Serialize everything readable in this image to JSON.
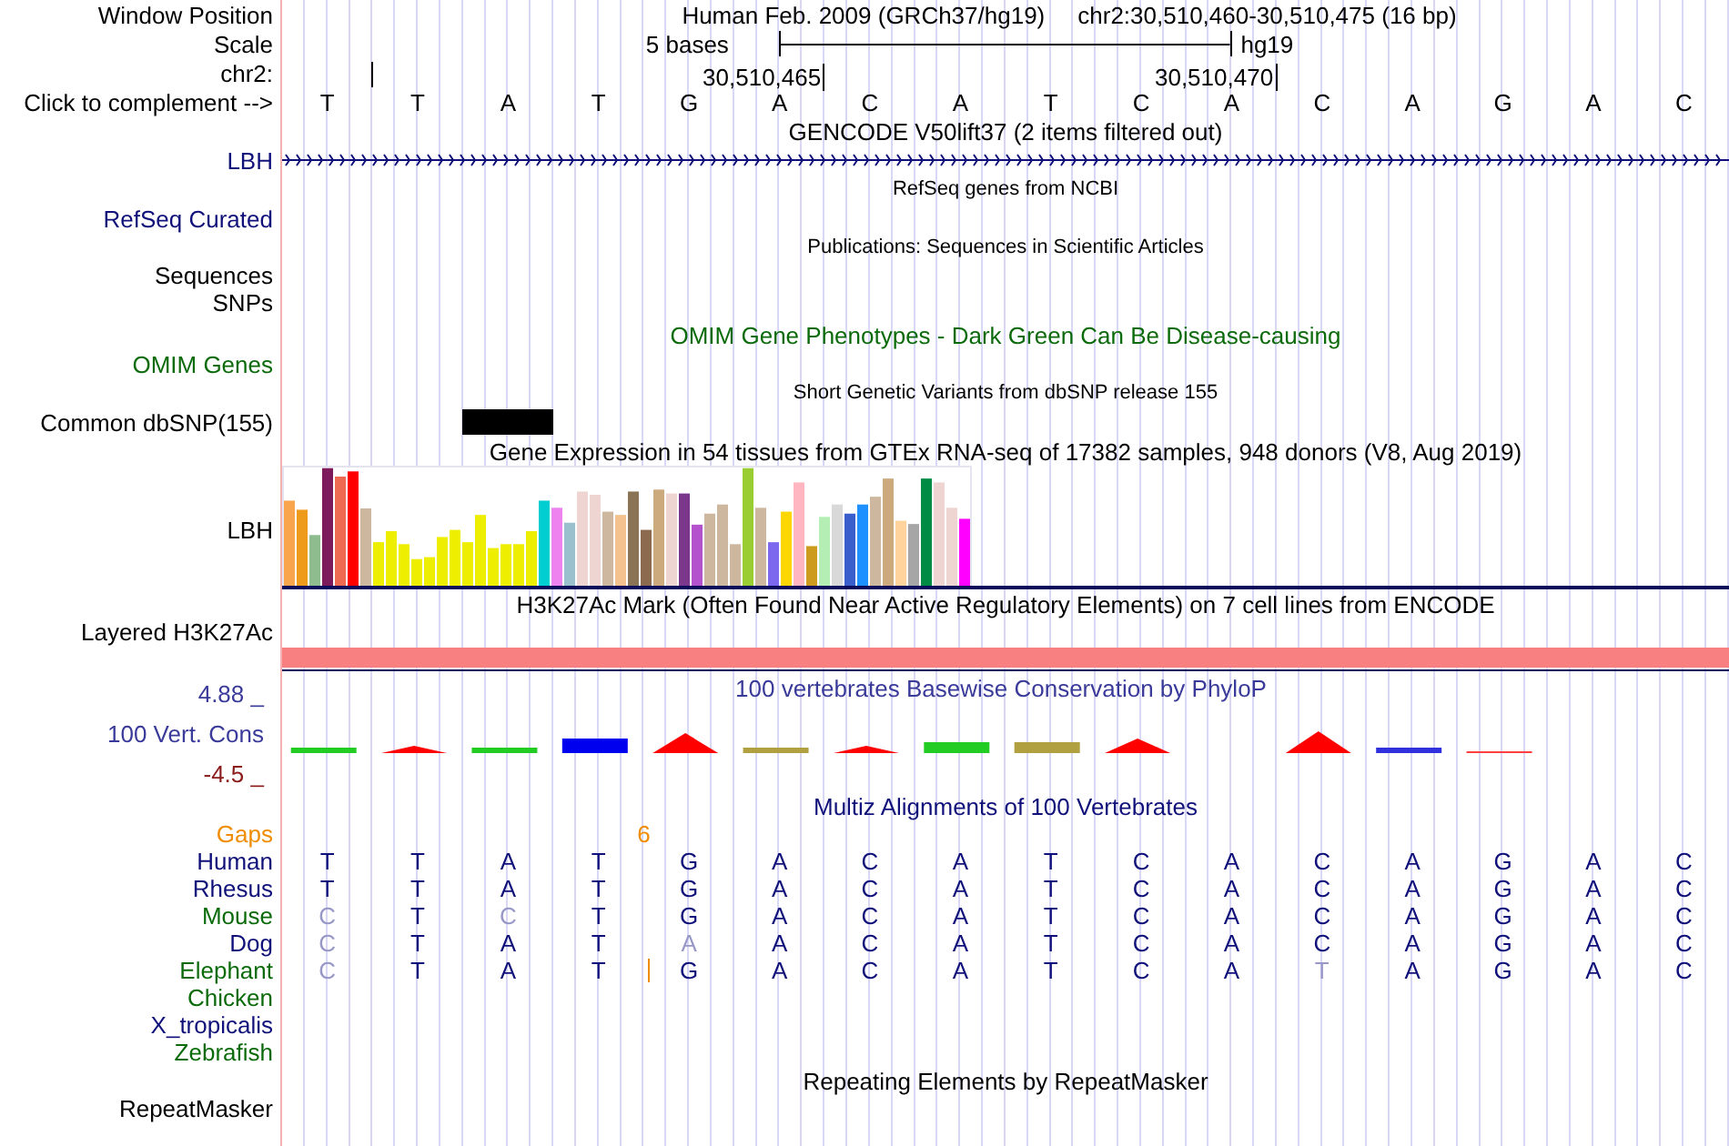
{
  "header": {
    "label": "Window Position",
    "assembly": "Human Feb. 2009 (GRCh37/hg19)",
    "position": "chr2:30,510,460-30,510,475 (16 bp)"
  },
  "scale": {
    "label": "Scale",
    "span": "5 bases",
    "assembly": "hg19"
  },
  "ruler": {
    "label": "chr2:",
    "ticks": [
      "30,510,465",
      "30,510,470"
    ]
  },
  "sequence": {
    "label": "Click to complement -->",
    "bases": [
      "T",
      "T",
      "A",
      "T",
      "G",
      "A",
      "C",
      "A",
      "T",
      "C",
      "A",
      "C",
      "A",
      "G",
      "A",
      "C"
    ]
  },
  "tracks": [
    {
      "kind": "title",
      "title": "GENCODE V50lift37 (2 items filtered out)",
      "color": "#000000"
    },
    {
      "kind": "gene",
      "label": "LBH",
      "color": "#10107a"
    },
    {
      "kind": "small_title",
      "title": "RefSeq genes from NCBI",
      "color": "#000000"
    },
    {
      "kind": "label",
      "label": "RefSeq Curated",
      "color": "#10107a"
    },
    {
      "kind": "small_title",
      "title": "Publications: Sequences in Scientific Articles",
      "color": "#000000"
    },
    {
      "kind": "label",
      "label": "Sequences",
      "color": "#000000"
    },
    {
      "kind": "label",
      "label": "SNPs",
      "color": "#000000"
    },
    {
      "kind": "title",
      "title": "OMIM Gene Phenotypes - Dark Green Can Be Disease-causing",
      "color": "#0b6b0b"
    },
    {
      "kind": "label",
      "label": "OMIM Genes",
      "color": "#0b6b0b"
    },
    {
      "kind": "small_title",
      "title": "Short Genetic Variants from dbSNP release 155",
      "color": "#000000"
    },
    {
      "kind": "snp",
      "label": "Common dbSNP(155)",
      "color": "#000000"
    },
    {
      "kind": "title",
      "title": "Gene Expression in 54 tissues from GTEx RNA-seq of 17382 samples, 948 donors (V8, Aug 2019)",
      "color": "#000000"
    },
    {
      "kind": "expression",
      "label": "LBH",
      "color": "#000000"
    },
    {
      "kind": "title",
      "title": "H3K27Ac Mark (Often Found Near Active Regulatory Elements) on 7 cell lines from ENCODE",
      "color": "#000000"
    },
    {
      "kind": "layered",
      "label": "Layered H3K27Ac",
      "color": "#000000"
    },
    {
      "kind": "conservation",
      "title": "100 vertebrates Basewise Conservation by PhyloP",
      "max": "4.88 _",
      "label": "100 Vert. Cons",
      "min": "-4.5 _"
    },
    {
      "kind": "title",
      "title": "Multiz Alignments of 100 Vertebrates",
      "color": "#10107a"
    },
    {
      "kind": "gaps",
      "label": "Gaps",
      "count": "6",
      "color": "#f08c00"
    },
    {
      "kind": "species",
      "label": "Human",
      "color": "#10107a",
      "bases": [
        {
          "base": "T",
          "faded": false
        },
        {
          "base": "T",
          "faded": false
        },
        {
          "base": "A",
          "faded": false
        },
        {
          "base": "T",
          "faded": false
        },
        {
          "base": "G",
          "faded": false
        },
        {
          "base": "A",
          "faded": false
        },
        {
          "base": "C",
          "faded": false
        },
        {
          "base": "A",
          "faded": false
        },
        {
          "base": "T",
          "faded": false
        },
        {
          "base": "C",
          "faded": false
        },
        {
          "base": "A",
          "faded": false
        },
        {
          "base": "C",
          "faded": false
        },
        {
          "base": "A",
          "faded": false
        },
        {
          "base": "G",
          "faded": false
        },
        {
          "base": "A",
          "faded": false
        },
        {
          "base": "C",
          "faded": false
        }
      ]
    },
    {
      "kind": "species",
      "label": "Rhesus",
      "color": "#10107a",
      "bases": [
        {
          "base": "T",
          "faded": false
        },
        {
          "base": "T",
          "faded": false
        },
        {
          "base": "A",
          "faded": false
        },
        {
          "base": "T",
          "faded": false
        },
        {
          "base": "G",
          "faded": false
        },
        {
          "base": "A",
          "faded": false
        },
        {
          "base": "C",
          "faded": false
        },
        {
          "base": "A",
          "faded": false
        },
        {
          "base": "T",
          "faded": false
        },
        {
          "base": "C",
          "faded": false
        },
        {
          "base": "A",
          "faded": false
        },
        {
          "base": "C",
          "faded": false
        },
        {
          "base": "A",
          "faded": false
        },
        {
          "base": "G",
          "faded": false
        },
        {
          "base": "A",
          "faded": false
        },
        {
          "base": "C",
          "faded": false
        }
      ]
    },
    {
      "kind": "species",
      "label": "Mouse",
      "color": "#0b6b0b",
      "bases": [
        {
          "base": "C",
          "faded": true
        },
        {
          "base": "T",
          "faded": false
        },
        {
          "base": "C",
          "faded": true
        },
        {
          "base": "T",
          "faded": false
        },
        {
          "base": "G",
          "faded": false
        },
        {
          "base": "A",
          "faded": false
        },
        {
          "base": "C",
          "faded": false
        },
        {
          "base": "A",
          "faded": false
        },
        {
          "base": "T",
          "faded": false
        },
        {
          "base": "C",
          "faded": false
        },
        {
          "base": "A",
          "faded": false
        },
        {
          "base": "C",
          "faded": false
        },
        {
          "base": "A",
          "faded": false
        },
        {
          "base": "G",
          "faded": false
        },
        {
          "base": "A",
          "faded": false
        },
        {
          "base": "C",
          "faded": false
        }
      ]
    },
    {
      "kind": "species",
      "label": "Dog",
      "color": "#10107a",
      "bases": [
        {
          "base": "C",
          "faded": true
        },
        {
          "base": "T",
          "faded": false
        },
        {
          "base": "A",
          "faded": false
        },
        {
          "base": "T",
          "faded": false
        },
        {
          "base": "A",
          "faded": true
        },
        {
          "base": "A",
          "faded": false
        },
        {
          "base": "C",
          "faded": false
        },
        {
          "base": "A",
          "faded": false
        },
        {
          "base": "T",
          "faded": false
        },
        {
          "base": "C",
          "faded": false
        },
        {
          "base": "A",
          "faded": false
        },
        {
          "base": "C",
          "faded": false
        },
        {
          "base": "A",
          "faded": false
        },
        {
          "base": "G",
          "faded": false
        },
        {
          "base": "A",
          "faded": false
        },
        {
          "base": "C",
          "faded": false
        }
      ]
    },
    {
      "kind": "species",
      "label": "Elephant",
      "color": "#0b6b0b",
      "insertion": true,
      "bases": [
        {
          "base": "C",
          "faded": true
        },
        {
          "base": "T",
          "faded": false
        },
        {
          "base": "A",
          "faded": false
        },
        {
          "base": "T",
          "faded": false
        },
        {
          "base": "G",
          "faded": false
        },
        {
          "base": "A",
          "faded": false
        },
        {
          "base": "C",
          "faded": false
        },
        {
          "base": "A",
          "faded": false
        },
        {
          "base": "T",
          "faded": false
        },
        {
          "base": "C",
          "faded": false
        },
        {
          "base": "A",
          "faded": false
        },
        {
          "base": "T",
          "faded": true
        },
        {
          "base": "A",
          "faded": false
        },
        {
          "base": "G",
          "faded": false
        },
        {
          "base": "A",
          "faded": false
        },
        {
          "base": "C",
          "faded": false
        }
      ]
    },
    {
      "kind": "species",
      "label": "Chicken",
      "color": "#0b6b0b"
    },
    {
      "kind": "species",
      "label": "X_tropicalis",
      "color": "#10107a"
    },
    {
      "kind": "species",
      "label": "Zebrafish",
      "color": "#0b6b0b"
    },
    {
      "kind": "title",
      "title": "Repeating Elements by RepeatMasker",
      "color": "#000000"
    },
    {
      "kind": "label",
      "label": "RepeatMasker",
      "color": "#000000"
    }
  ]
}
